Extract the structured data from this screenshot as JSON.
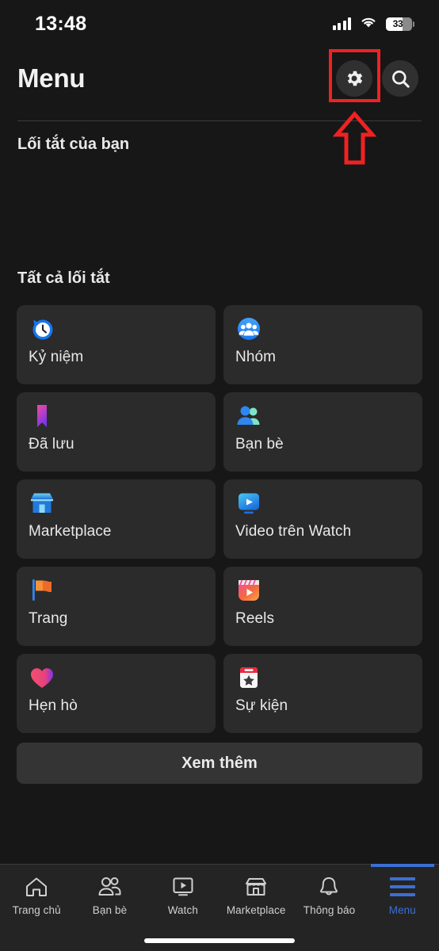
{
  "status_bar": {
    "time": "13:48",
    "signal_icon": "cellular-signal-icon",
    "wifi_icon": "wifi-icon",
    "battery_icon": "battery-icon",
    "battery_level": "33"
  },
  "header": {
    "title": "Menu",
    "settings_icon": "gear-icon",
    "search_icon": "search-icon"
  },
  "annotation": {
    "highlight_box_color": "#ef2222",
    "arrow_icon": "up-arrow-icon",
    "arrow_color": "#ef2222",
    "target": "gear-icon"
  },
  "sections": {
    "your_shortcuts_title": "Lối tắt của bạn",
    "all_shortcuts_title": "Tất cả lối tắt"
  },
  "shortcuts": [
    {
      "label": "Kỷ niệm",
      "icon": "memories-clock-icon"
    },
    {
      "label": "Nhóm",
      "icon": "groups-icon"
    },
    {
      "label": "Đã lưu",
      "icon": "saved-bookmark-icon"
    },
    {
      "label": "Bạn bè",
      "icon": "friends-icon"
    },
    {
      "label": "Marketplace",
      "icon": "marketplace-storefront-icon"
    },
    {
      "label": "Video trên Watch",
      "icon": "watch-video-icon"
    },
    {
      "label": "Trang",
      "icon": "pages-flag-icon"
    },
    {
      "label": "Reels",
      "icon": "reels-clapperboard-icon"
    },
    {
      "label": "Hẹn hò",
      "icon": "dating-heart-icon"
    },
    {
      "label": "Sự kiện",
      "icon": "events-calendar-icon"
    }
  ],
  "see_more_label": "Xem thêm",
  "bottom_nav": {
    "active_color": "#3b6fd4",
    "items": [
      {
        "label": "Trang chủ",
        "icon": "home-icon",
        "active": false
      },
      {
        "label": "Bạn bè",
        "icon": "friends-icon",
        "active": false
      },
      {
        "label": "Watch",
        "icon": "watch-icon",
        "active": false
      },
      {
        "label": "Marketplace",
        "icon": "storefront-icon",
        "active": false
      },
      {
        "label": "Thông báo",
        "icon": "bell-icon",
        "active": false
      },
      {
        "label": "Menu",
        "icon": "hamburger-icon",
        "active": true
      }
    ]
  }
}
